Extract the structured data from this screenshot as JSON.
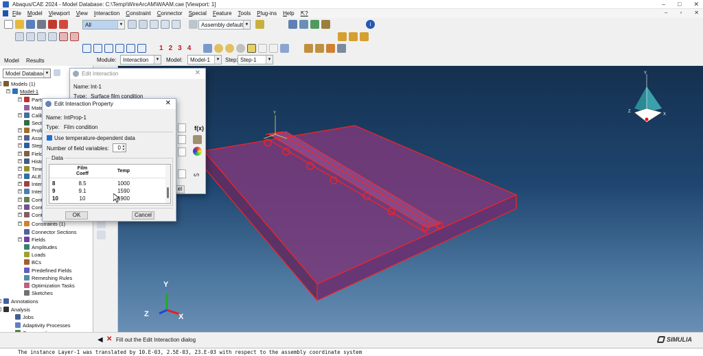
{
  "window": {
    "title": "Abaqus/CAE 2024 - Model Database: C:\\Temp\\WireArcAM\\WAAM.cae [Viewport: 1]",
    "minimize": "–",
    "maximize": "□",
    "close": "✕"
  },
  "menu": [
    "File",
    "Model",
    "Viewport",
    "View",
    "Interaction",
    "Constraint",
    "Connector",
    "Special",
    "Feature",
    "Tools",
    "Plug-ins",
    "Help",
    "⇱?"
  ],
  "toolbar": {
    "selection_filter": "All",
    "render_style": "Assembly defaults",
    "numbers": [
      "1",
      "2",
      "3",
      "4"
    ]
  },
  "tabs": {
    "model": "Model",
    "results": "Results"
  },
  "module_bar": {
    "module_label": "Module:",
    "module_value": "Interaction",
    "model_label": "Model:",
    "model_value": "Model-1",
    "step_label": "Step:",
    "step_value": "Step-1"
  },
  "tree": {
    "selector": "Model Database",
    "items": [
      {
        "label": "Models (1)",
        "icon": "models-icon"
      },
      {
        "label": "Model-1",
        "icon": "model-icon"
      },
      {
        "label": "Parts",
        "icon": "parts-icon"
      },
      {
        "label": "Mate",
        "icon": "materials-icon"
      },
      {
        "label": "Calib",
        "icon": "calibrations-icon"
      },
      {
        "label": "Secti",
        "icon": "sections-icon"
      },
      {
        "label": "Profi",
        "icon": "profiles-icon"
      },
      {
        "label": "Asse",
        "icon": "assembly-icon"
      },
      {
        "label": "Steps",
        "icon": "steps-icon"
      },
      {
        "label": "Field",
        "icon": "field-output-icon"
      },
      {
        "label": "Histo",
        "icon": "history-output-icon"
      },
      {
        "label": "Time",
        "icon": "time-points-icon"
      },
      {
        "label": "ALE A",
        "icon": "ale-icon"
      },
      {
        "label": "Intera",
        "icon": "interactions-icon"
      },
      {
        "label": "Intera",
        "icon": "interaction-props-icon"
      },
      {
        "label": "Cont",
        "icon": "contact-controls-icon"
      },
      {
        "label": "Cont",
        "icon": "contact-init-icon"
      },
      {
        "label": "Cont",
        "icon": "contact-stab-icon"
      },
      {
        "label": "Constraints (1)",
        "icon": "constraints-icon"
      },
      {
        "label": "Connector Sections",
        "icon": "connector-icon"
      },
      {
        "label": "Fields",
        "icon": "fields-icon"
      },
      {
        "label": "Amplitudes",
        "icon": "amplitudes-icon"
      },
      {
        "label": "Loads",
        "icon": "loads-icon"
      },
      {
        "label": "BCs",
        "icon": "bcs-icon"
      },
      {
        "label": "Predefined Fields",
        "icon": "predefined-icon"
      },
      {
        "label": "Remeshing Rules",
        "icon": "remesh-icon"
      },
      {
        "label": "Optimization Tasks",
        "icon": "optimization-icon"
      },
      {
        "label": "Sketches",
        "icon": "sketches-icon"
      },
      {
        "label": "Annotations",
        "icon": "annotations-icon"
      },
      {
        "label": "Analysis",
        "icon": "analysis-icon"
      },
      {
        "label": "Jobs",
        "icon": "jobs-icon"
      },
      {
        "label": "Adaptivity Processes",
        "icon": "adaptivity-icon"
      },
      {
        "label": "Co-executions",
        "icon": "coexec-icon"
      }
    ]
  },
  "edit_interaction": {
    "title": "Edit Interaction",
    "name_label": "Name:",
    "name": "Int-1",
    "type_label": "Type:",
    "type": "Surface film condition",
    "fx": "f(x)",
    "close_fragment": "el"
  },
  "edit_property": {
    "title": "Edit Interaction Property",
    "name_label": "Name:",
    "name": "IntProp-1",
    "type_label": "Type:",
    "type": "Film condition",
    "temp_dep_label": "Use temperature-dependent data",
    "fields_label": "Number of field variables:",
    "fields_value": "0",
    "data_label": "Data",
    "col1": "Film\nCoeff",
    "col2": "Temp",
    "rows": [
      {
        "n": "8",
        "coeff": "8.5",
        "temp": "1000"
      },
      {
        "n": "9",
        "coeff": "9.1",
        "temp": "1590"
      },
      {
        "n": "10",
        "coeff": "10",
        "temp": "1900"
      }
    ],
    "ok": "OK",
    "cancel": "Cancel"
  },
  "axes": {
    "y": "Y",
    "z": "Z",
    "x": "X"
  },
  "prompt": {
    "text": "Fill out the Edit Interaction dialog",
    "cancel": "✕"
  },
  "brand": "SIMULIA",
  "console": "The instance Layer-1 was translated by 10.E-03, 2.5E-03, 23.E-03 with respect to the assembly coordinate system"
}
